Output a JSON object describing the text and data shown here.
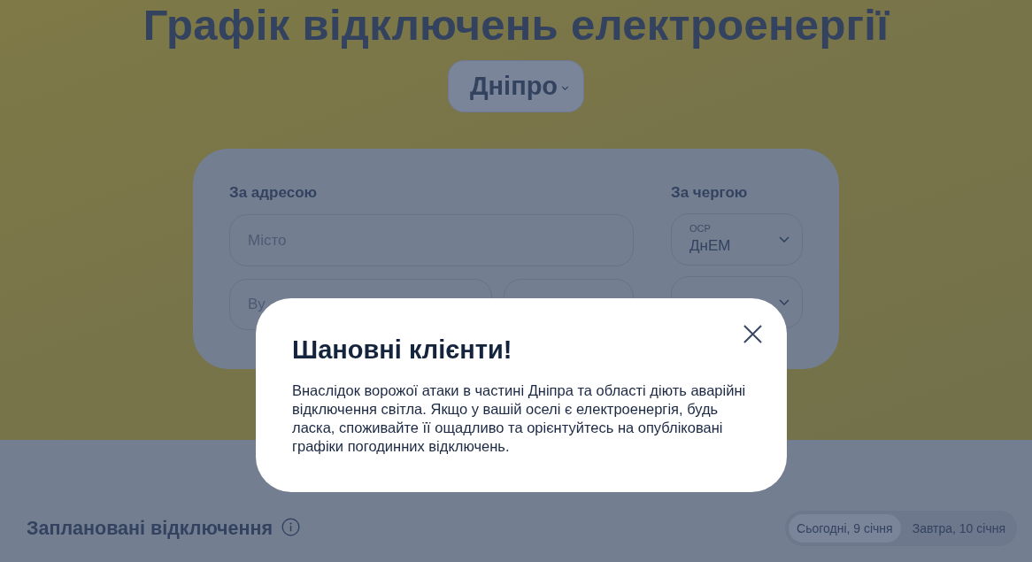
{
  "header": {
    "title": "Графік відключень електроенергії",
    "city_select": {
      "value": "Дніпро"
    }
  },
  "search_form": {
    "by_address": {
      "heading": "За адресою",
      "city_field": {
        "placeholder": "Місто"
      },
      "street_field": {
        "placeholder": "Ву"
      }
    },
    "by_queue": {
      "heading": "За чергою",
      "operator_select": {
        "label": "ОСР",
        "value": "ДнЕМ"
      }
    }
  },
  "modal": {
    "title": "Шановні клієнти!",
    "text": "Внаслідок ворожої атаки в частині Дніпра та області діють аварійні відключення світла. Якщо у вашій оселі є електроенергія, будь ласка, споживайте її ощадливо та орієнтуйтесь на опубліковані графіки погодинних відключень."
  },
  "planned_outages": {
    "heading": "Заплановані відключення",
    "day_tabs": [
      {
        "label": "Сьогодні, 9 січня",
        "selected": true
      },
      {
        "label": "Завтра, 10 січня",
        "selected": false
      }
    ]
  }
}
